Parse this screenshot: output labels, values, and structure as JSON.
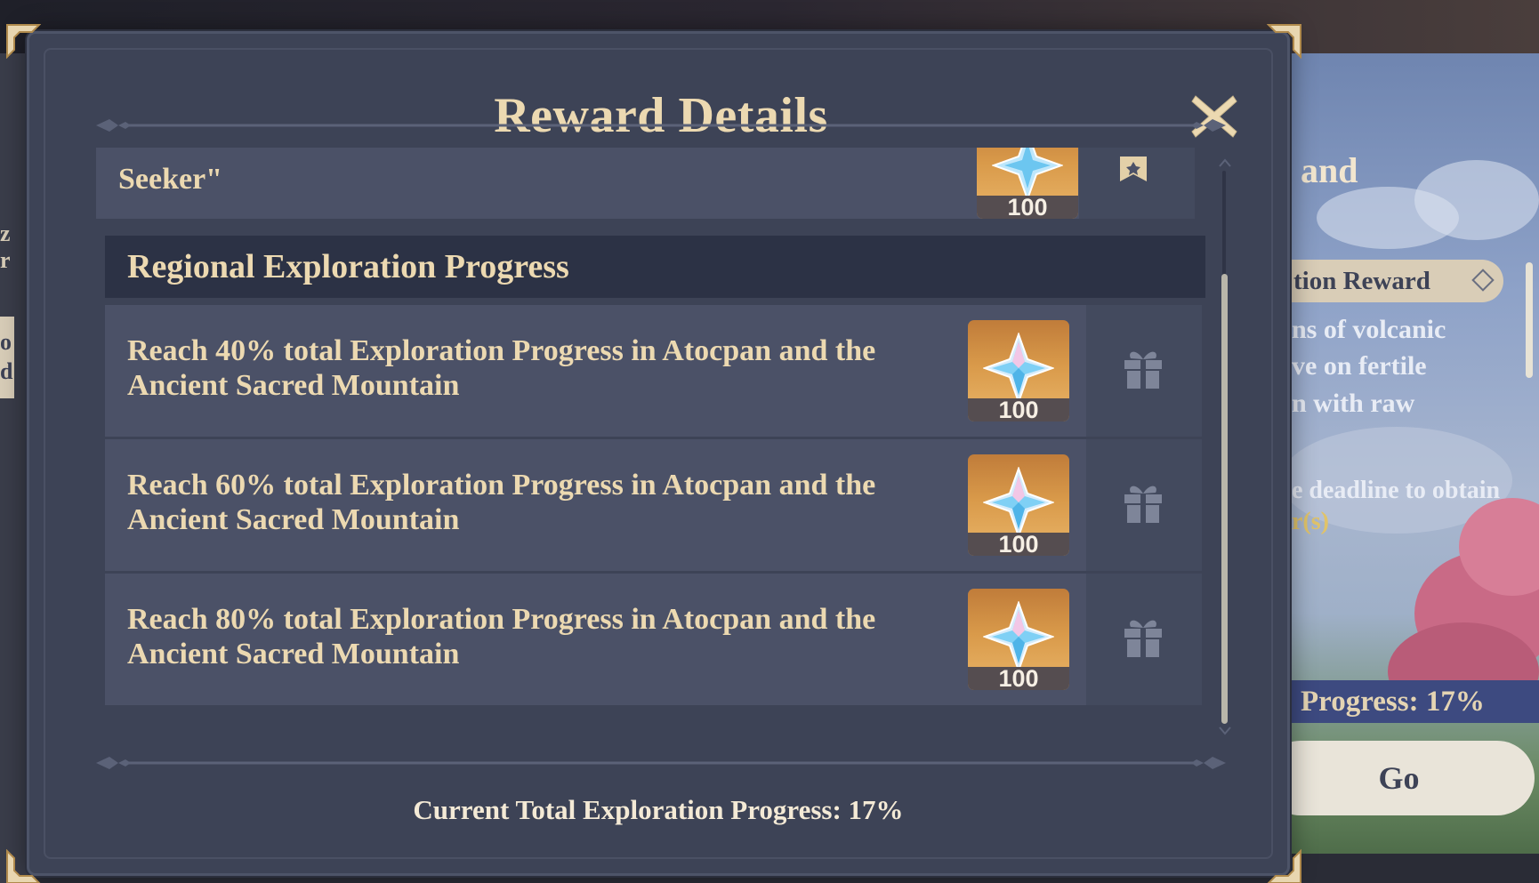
{
  "dialog": {
    "title": "Reward Details",
    "close_icon": "close-icon",
    "partial_card": {
      "text": "Seeker\"",
      "reward_count": "100",
      "reward_icon": "primogem-icon",
      "status_icon": "claimed-bookmark-icon"
    },
    "section": {
      "title": "Regional Exploration Progress",
      "items": [
        {
          "text": "Reach 40% total Exploration Progress in Atocpan and the Ancient Sacred Mountain",
          "reward_count": "100",
          "reward_icon": "primogem-icon",
          "status_icon": "gift-icon"
        },
        {
          "text": "Reach 60% total Exploration Progress in Atocpan and the Ancient Sacred Mountain",
          "reward_count": "100",
          "reward_icon": "primogem-icon",
          "status_icon": "gift-icon"
        },
        {
          "text": "Reach 80% total Exploration Progress in Atocpan and the Ancient Sacred Mountain",
          "reward_count": "100",
          "reward_icon": "primogem-icon",
          "status_icon": "gift-icon"
        }
      ]
    },
    "footer": "Current Total Exploration Progress: 17%"
  },
  "background": {
    "left_fragments": [
      "z",
      "r",
      "o",
      "d"
    ],
    "right_title_fragment": "and",
    "reward_label_fragment": "tion Reward",
    "desc_lines": [
      "ns of volcanic",
      "ve on fertile",
      "n with raw"
    ],
    "deadline_line1": "e deadline to obtain",
    "deadline_line2": "r(s)",
    "progress_label": "Progress: 17%",
    "go_button": "Go"
  },
  "colors": {
    "dialog_bg": "#3d4356",
    "card_bg": "#4b5167",
    "section_header_bg": "#2c3245",
    "text_gold": "#ecd9b1",
    "reward_bg": "#d99a4a"
  }
}
